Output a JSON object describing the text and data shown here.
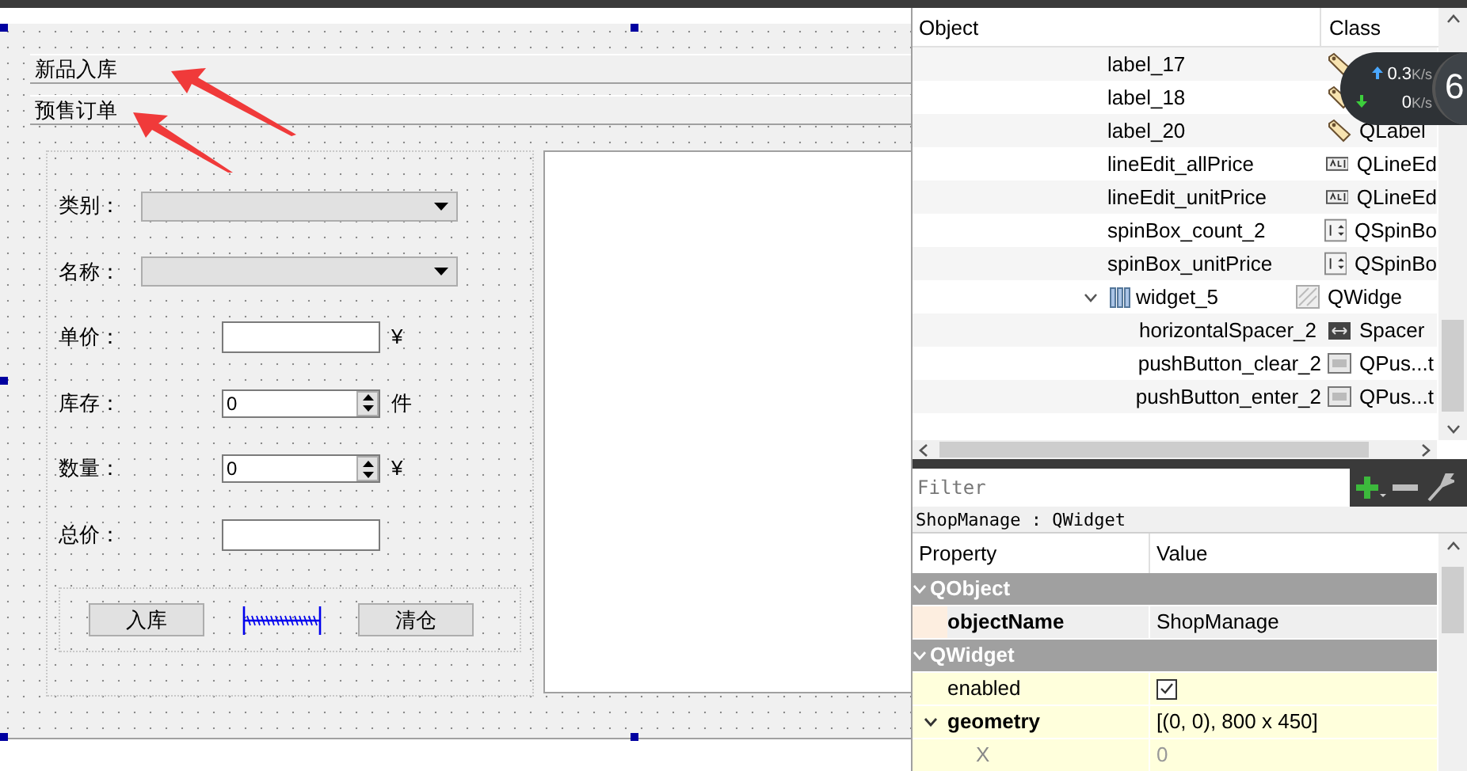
{
  "form": {
    "toolbox_pages": [
      {
        "label": "新品入库"
      },
      {
        "label": "预售订单"
      }
    ],
    "fields": [
      {
        "kind": "combo",
        "label": "类别："
      },
      {
        "kind": "combo",
        "label": "名称："
      },
      {
        "kind": "line",
        "label": "单价：",
        "unit": "¥"
      },
      {
        "kind": "spin",
        "label": "库存：",
        "value": "0",
        "unit": "件"
      },
      {
        "kind": "spin",
        "label": "数量：",
        "value": "0",
        "unit": "¥"
      },
      {
        "kind": "line",
        "label": "总价："
      }
    ],
    "buttons": [
      {
        "kind": "button",
        "label": "入库"
      },
      {
        "kind": "spacer"
      },
      {
        "kind": "button",
        "label": "清仓"
      }
    ]
  },
  "object_inspector": {
    "columns": [
      "Object",
      "Class"
    ],
    "rows": [
      {
        "name": "label_17",
        "kind": "label"
      },
      {
        "name": "label_18",
        "kind": "label"
      },
      {
        "name": "label_20",
        "kind": "label",
        "class": "QLabel"
      },
      {
        "name": "lineEdit_allPrice",
        "kind": "lineedit",
        "class": "QLineEd"
      },
      {
        "name": "lineEdit_unitPrice",
        "kind": "lineedit",
        "class": "QLineEd"
      },
      {
        "name": "spinBox_count_2",
        "kind": "spinbox",
        "class": "QSpinBo"
      },
      {
        "name": "spinBox_unitPrice",
        "kind": "spinbox",
        "class": "QSpinBo"
      },
      {
        "name": "widget_5",
        "kind": "widget",
        "class": "QWidge",
        "expanded": true,
        "children": [
          {
            "name": "horizontalSpacer_2",
            "kind": "spacer",
            "class": "Spacer"
          },
          {
            "name": "pushButton_clear_2",
            "kind": "button",
            "class": "QPus...t"
          },
          {
            "name": "pushButton_enter_2",
            "kind": "button",
            "class": "QPus...t"
          }
        ]
      }
    ]
  },
  "property_editor": {
    "filter_placeholder": "Filter",
    "object_label": "ShopManage : QWidget",
    "columns": [
      "Property",
      "Value"
    ],
    "rows": [
      {
        "kind": "group",
        "name": "QObject",
        "expanded": true
      },
      {
        "kind": "property",
        "name": "objectName",
        "changed": true,
        "value": "ShopManage"
      },
      {
        "kind": "group",
        "name": "QWidget",
        "expanded": true
      },
      {
        "kind": "checkbox",
        "name": "enabled",
        "changed": false,
        "checked": true
      },
      {
        "kind": "property",
        "name": "geometry",
        "changed": true,
        "expanded": true,
        "value": "[(0, 0), 800 x 450]"
      },
      {
        "kind": "subproperty",
        "name": "X",
        "value": "0"
      }
    ]
  },
  "net_monitor": {
    "upload": "0.3",
    "upload_unit": "K/s",
    "download": "0",
    "download_unit": "K/s",
    "badge": "6"
  }
}
